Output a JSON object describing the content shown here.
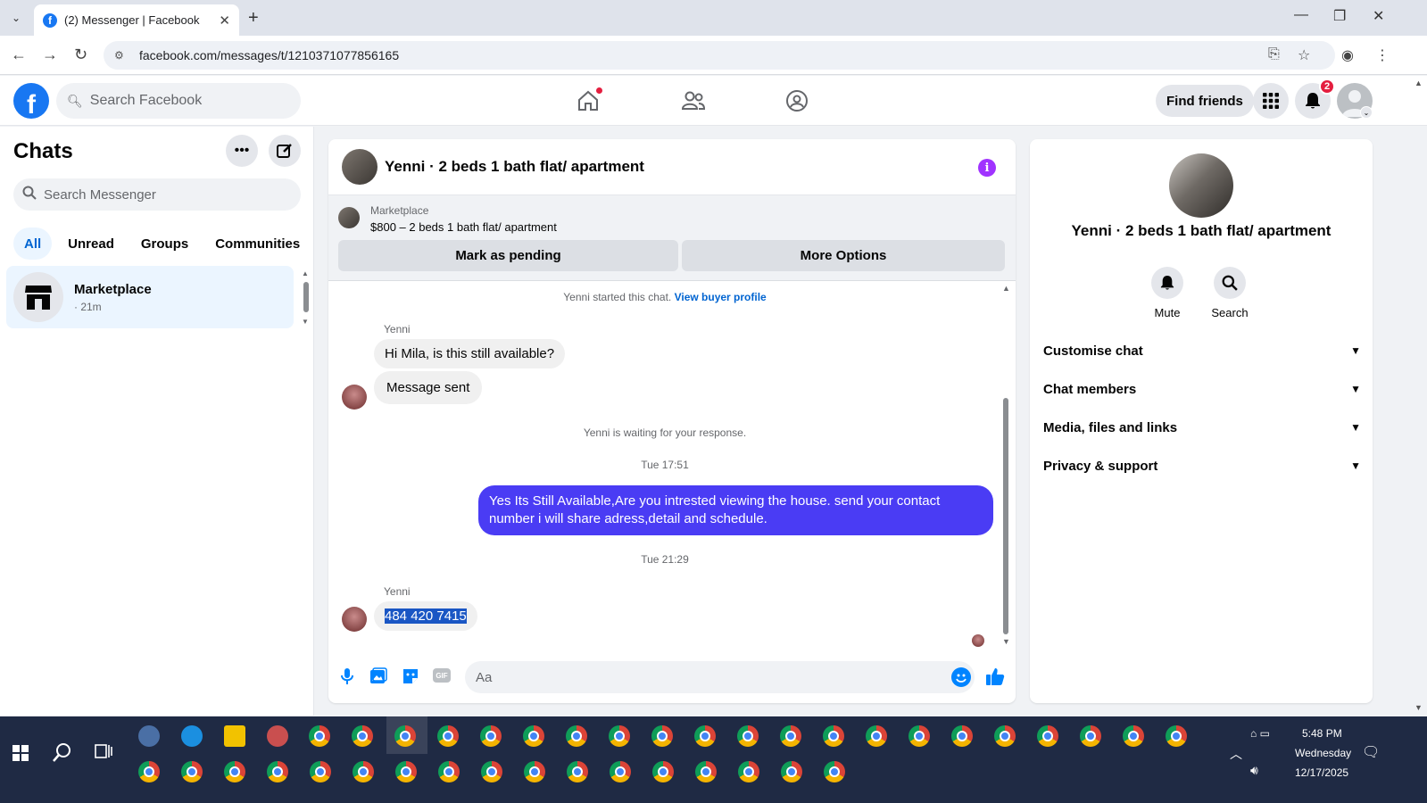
{
  "browser": {
    "tab_title": "(2) Messenger | Facebook",
    "url": "facebook.com/messages/t/1210371077856165"
  },
  "fbnav": {
    "search_placeholder": "Search Facebook",
    "find_friends": "Find friends",
    "notification_count": "2"
  },
  "sidebar": {
    "title": "Chats",
    "search_placeholder": "Search Messenger",
    "filters": [
      "All",
      "Unread",
      "Groups",
      "Communities"
    ],
    "active_filter": "All",
    "chat": {
      "name": "Marketplace",
      "time": "· 21m"
    }
  },
  "chat": {
    "header_title": "Yenni · 2 beds 1 bath flat/ apartment",
    "marketplace_label": "Marketplace",
    "listing": "$800 – 2 beds 1 bath flat/ apartment",
    "mark_pending": "Mark as pending",
    "more_options": "More Options",
    "started_text": "Yenni started this chat.",
    "buyer_profile_link": "View buyer profile",
    "sender1": "Yenni",
    "msg1": "Hi Mila, is this still available?",
    "msg2": "Message sent",
    "waiting_text": "Yenni is waiting for your response.",
    "time1": "Tue 17:51",
    "outgoing": "Yes Its Still Available,Are you intrested viewing the house. send your contact number i will share adress,detail and schedule.",
    "time2": "Tue 21:29",
    "sender2": "Yenni",
    "msg3": "484 420 7415",
    "composer_placeholder": "Aa"
  },
  "rightpanel": {
    "name": "Yenni · 2 beds 1 bath flat/ apartment",
    "mute": "Mute",
    "search": "Search",
    "sections": [
      "Customise chat",
      "Chat members",
      "Media, files and links",
      "Privacy & support"
    ]
  },
  "taskbar": {
    "time": "5:48 PM",
    "day": "Wednesday",
    "date": "12/17/2025"
  },
  "colors": {
    "fb_blue": "#1877f2",
    "outgoing_bubble": "#4a3cf4",
    "active_chat_bg": "#ebf5ff",
    "taskbar": "#1f2a44"
  }
}
